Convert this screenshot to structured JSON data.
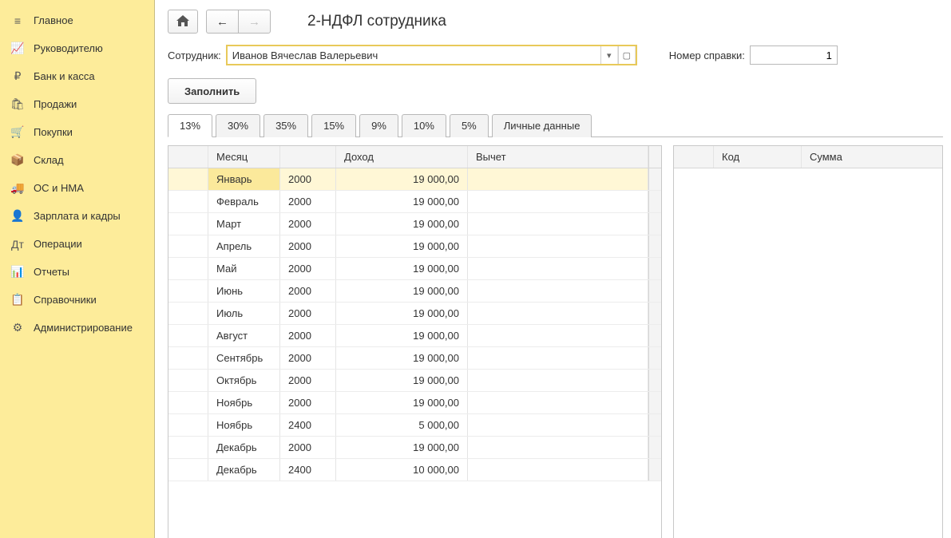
{
  "sidebar": {
    "items": [
      {
        "icon": "menu-icon",
        "glyph": "≡",
        "label": "Главное"
      },
      {
        "icon": "chart-icon",
        "glyph": "📈",
        "label": "Руководителю"
      },
      {
        "icon": "money-icon",
        "glyph": "₽",
        "label": "Банк и касса"
      },
      {
        "icon": "bag-icon",
        "glyph": "🛍",
        "label": "Продажи"
      },
      {
        "icon": "cart-icon",
        "glyph": "🛒",
        "label": "Покупки"
      },
      {
        "icon": "box-icon",
        "glyph": "📦",
        "label": "Склад"
      },
      {
        "icon": "truck-icon",
        "glyph": "🚚",
        "label": "ОС и НМА"
      },
      {
        "icon": "person-icon",
        "glyph": "👤",
        "label": "Зарплата и кадры"
      },
      {
        "icon": "ops-icon",
        "glyph": "Дт",
        "label": "Операции"
      },
      {
        "icon": "bars-icon",
        "glyph": "📊",
        "label": "Отчеты"
      },
      {
        "icon": "book-icon",
        "glyph": "📋",
        "label": "Справочники"
      },
      {
        "icon": "gear-icon",
        "glyph": "⚙",
        "label": "Администрирование"
      }
    ]
  },
  "header": {
    "title": "2-НДФЛ сотрудника"
  },
  "form": {
    "employee_label": "Сотрудник:",
    "employee_value": "Иванов Вячеслав Валерьевич",
    "ref_label": "Номер справки:",
    "ref_value": "1",
    "fill_button": "Заполнить"
  },
  "tabs": [
    "13%",
    "30%",
    "35%",
    "15%",
    "9%",
    "10%",
    "5%",
    "Личные данные"
  ],
  "active_tab": 0,
  "grid": {
    "headers": {
      "month": "Месяц",
      "income": "Доход",
      "deduction": "Вычет"
    },
    "rows": [
      {
        "month": "Январь",
        "code": "2000",
        "amount": "19 000,00",
        "selected": true
      },
      {
        "month": "Февраль",
        "code": "2000",
        "amount": "19 000,00"
      },
      {
        "month": "Март",
        "code": "2000",
        "amount": "19 000,00"
      },
      {
        "month": "Апрель",
        "code": "2000",
        "amount": "19 000,00"
      },
      {
        "month": "Май",
        "code": "2000",
        "amount": "19 000,00"
      },
      {
        "month": "Июнь",
        "code": "2000",
        "amount": "19 000,00"
      },
      {
        "month": "Июль",
        "code": "2000",
        "amount": "19 000,00"
      },
      {
        "month": "Август",
        "code": "2000",
        "amount": "19 000,00"
      },
      {
        "month": "Сентябрь",
        "code": "2000",
        "amount": "19 000,00"
      },
      {
        "month": "Октябрь",
        "code": "2000",
        "amount": "19 000,00"
      },
      {
        "month": "Ноябрь",
        "code": "2000",
        "amount": "19 000,00"
      },
      {
        "month": "Ноябрь",
        "code": "2400",
        "amount": "5 000,00"
      },
      {
        "month": "Декабрь",
        "code": "2000",
        "amount": "19 000,00"
      },
      {
        "month": "Декабрь",
        "code": "2400",
        "amount": "10 000,00"
      }
    ]
  },
  "right_grid": {
    "headers": {
      "code": "Код",
      "sum": "Сумма"
    }
  }
}
